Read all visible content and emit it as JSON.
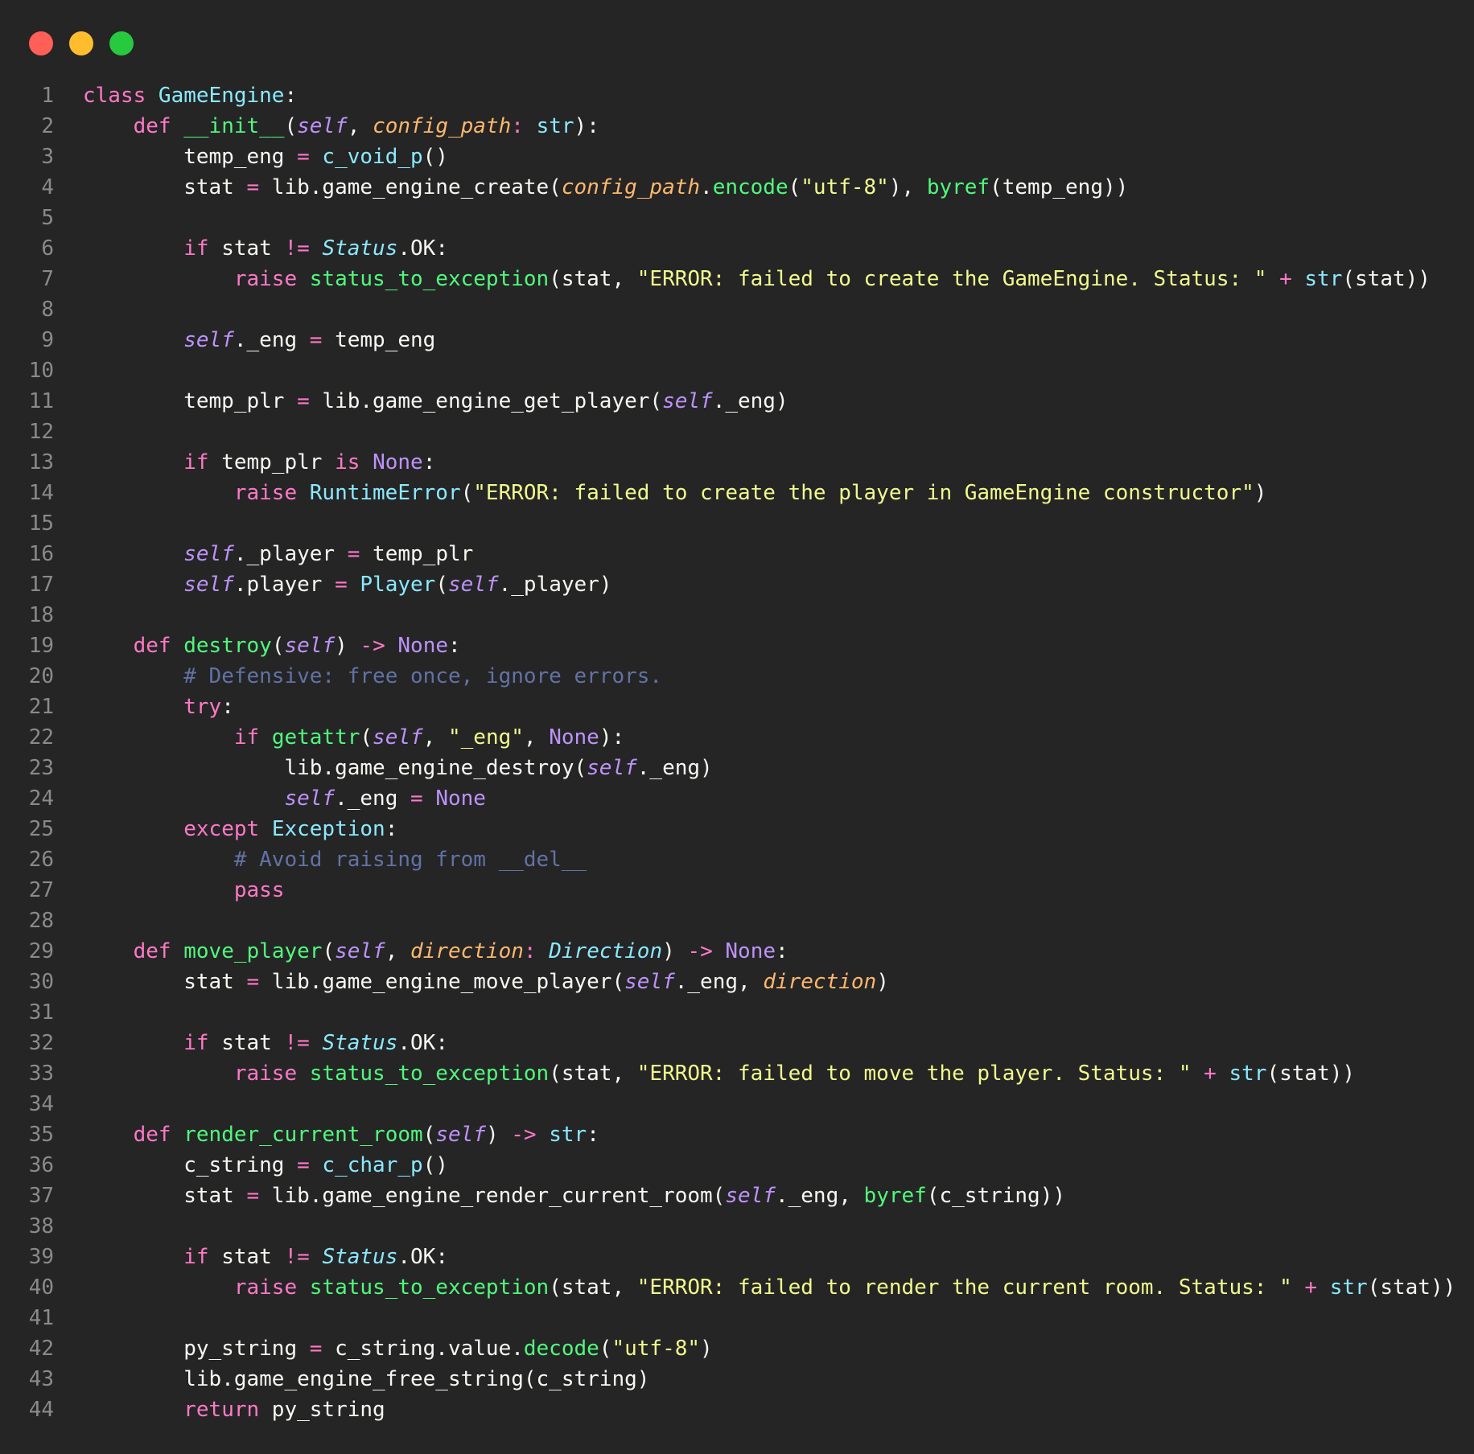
{
  "window": {
    "controls": {
      "close": "close-icon",
      "minimize": "minimize-icon",
      "maximize": "maximize-icon"
    },
    "colors": {
      "background": "#252526",
      "close": "#ff5f56",
      "minimize": "#ffbd2e",
      "maximize": "#27c93f"
    }
  },
  "editor": {
    "lines": [
      [
        [
          "kw",
          "class "
        ],
        [
          "cls",
          "GameEngine"
        ],
        [
          "p",
          ":"
        ]
      ],
      [
        [
          "p",
          "    "
        ],
        [
          "kw",
          "def "
        ],
        [
          "fn",
          "__init__"
        ],
        [
          "p",
          "("
        ],
        [
          "self",
          "self"
        ],
        [
          "p",
          ", "
        ],
        [
          "param",
          "config_path"
        ],
        [
          "op",
          ": "
        ],
        [
          "builtin",
          "str"
        ],
        [
          "p",
          "):"
        ]
      ],
      [
        [
          "p",
          "        temp_eng "
        ],
        [
          "op",
          "="
        ],
        [
          "p",
          " "
        ],
        [
          "cls",
          "c_void_p"
        ],
        [
          "p",
          "()"
        ]
      ],
      [
        [
          "p",
          "        stat "
        ],
        [
          "op",
          "="
        ],
        [
          "p",
          " lib.game_engine_create("
        ],
        [
          "param",
          "config_path"
        ],
        [
          "p",
          "."
        ],
        [
          "fn",
          "encode"
        ],
        [
          "p",
          "("
        ],
        [
          "str",
          "\"utf-8\""
        ],
        [
          "p",
          "), "
        ],
        [
          "fn",
          "byref"
        ],
        [
          "p",
          "(temp_eng))"
        ]
      ],
      [
        [
          "p",
          ""
        ]
      ],
      [
        [
          "p",
          "        "
        ],
        [
          "kw",
          "if"
        ],
        [
          "p",
          " stat "
        ],
        [
          "op",
          "!="
        ],
        [
          "p",
          " "
        ],
        [
          "type",
          "Status"
        ],
        [
          "p",
          ".OK:"
        ]
      ],
      [
        [
          "p",
          "            "
        ],
        [
          "kw",
          "raise "
        ],
        [
          "fn",
          "status_to_exception"
        ],
        [
          "p",
          "(stat, "
        ],
        [
          "str",
          "\"ERROR: failed to create the GameEngine. Status: \""
        ],
        [
          "p",
          " "
        ],
        [
          "op",
          "+"
        ],
        [
          "p",
          " "
        ],
        [
          "builtin",
          "str"
        ],
        [
          "p",
          "(stat))"
        ]
      ],
      [
        [
          "p",
          ""
        ]
      ],
      [
        [
          "p",
          "        "
        ],
        [
          "self",
          "self"
        ],
        [
          "p",
          "._eng "
        ],
        [
          "op",
          "="
        ],
        [
          "p",
          " temp_eng"
        ]
      ],
      [
        [
          "p",
          ""
        ]
      ],
      [
        [
          "p",
          "        temp_plr "
        ],
        [
          "op",
          "="
        ],
        [
          "p",
          " lib.game_engine_get_player("
        ],
        [
          "self",
          "self"
        ],
        [
          "p",
          "._eng)"
        ]
      ],
      [
        [
          "p",
          ""
        ]
      ],
      [
        [
          "p",
          "        "
        ],
        [
          "kw",
          "if"
        ],
        [
          "p",
          " temp_plr "
        ],
        [
          "kw",
          "is"
        ],
        [
          "p",
          " "
        ],
        [
          "const",
          "None"
        ],
        [
          "p",
          ":"
        ]
      ],
      [
        [
          "p",
          "            "
        ],
        [
          "kw",
          "raise "
        ],
        [
          "cls",
          "RuntimeError"
        ],
        [
          "p",
          "("
        ],
        [
          "str",
          "\"ERROR: failed to create the player in GameEngine constructor\""
        ],
        [
          "p",
          ")"
        ]
      ],
      [
        [
          "p",
          ""
        ]
      ],
      [
        [
          "p",
          "        "
        ],
        [
          "self",
          "self"
        ],
        [
          "p",
          "._player "
        ],
        [
          "op",
          "="
        ],
        [
          "p",
          " temp_plr"
        ]
      ],
      [
        [
          "p",
          "        "
        ],
        [
          "self",
          "self"
        ],
        [
          "p",
          ".player "
        ],
        [
          "op",
          "="
        ],
        [
          "p",
          " "
        ],
        [
          "cls",
          "Player"
        ],
        [
          "p",
          "("
        ],
        [
          "self",
          "self"
        ],
        [
          "p",
          "._player)"
        ]
      ],
      [
        [
          "p",
          ""
        ]
      ],
      [
        [
          "p",
          "    "
        ],
        [
          "kw",
          "def "
        ],
        [
          "fn",
          "destroy"
        ],
        [
          "p",
          "("
        ],
        [
          "self",
          "self"
        ],
        [
          "p",
          ") "
        ],
        [
          "op",
          "->"
        ],
        [
          "p",
          " "
        ],
        [
          "const",
          "None"
        ],
        [
          "p",
          ":"
        ]
      ],
      [
        [
          "p",
          "        "
        ],
        [
          "com",
          "# Defensive: free once, ignore errors."
        ]
      ],
      [
        [
          "p",
          "        "
        ],
        [
          "kw",
          "try"
        ],
        [
          "p",
          ":"
        ]
      ],
      [
        [
          "p",
          "            "
        ],
        [
          "kw",
          "if"
        ],
        [
          "p",
          " "
        ],
        [
          "fn",
          "getattr"
        ],
        [
          "p",
          "("
        ],
        [
          "self",
          "self"
        ],
        [
          "p",
          ", "
        ],
        [
          "str",
          "\"_eng\""
        ],
        [
          "p",
          ", "
        ],
        [
          "const",
          "None"
        ],
        [
          "p",
          "):"
        ]
      ],
      [
        [
          "p",
          "                lib.game_engine_destroy("
        ],
        [
          "self",
          "self"
        ],
        [
          "p",
          "._eng)"
        ]
      ],
      [
        [
          "p",
          "                "
        ],
        [
          "self",
          "self"
        ],
        [
          "p",
          "._eng "
        ],
        [
          "op",
          "="
        ],
        [
          "p",
          " "
        ],
        [
          "const",
          "None"
        ]
      ],
      [
        [
          "p",
          "        "
        ],
        [
          "kw",
          "except "
        ],
        [
          "cls",
          "Exception"
        ],
        [
          "p",
          ":"
        ]
      ],
      [
        [
          "p",
          "            "
        ],
        [
          "com",
          "# Avoid raising from __del__"
        ]
      ],
      [
        [
          "p",
          "            "
        ],
        [
          "kw",
          "pass"
        ]
      ],
      [
        [
          "p",
          ""
        ]
      ],
      [
        [
          "p",
          "    "
        ],
        [
          "kw",
          "def "
        ],
        [
          "fn",
          "move_player"
        ],
        [
          "p",
          "("
        ],
        [
          "self",
          "self"
        ],
        [
          "p",
          ", "
        ],
        [
          "param",
          "direction"
        ],
        [
          "op",
          ": "
        ],
        [
          "type",
          "Direction"
        ],
        [
          "p",
          ") "
        ],
        [
          "op",
          "->"
        ],
        [
          "p",
          " "
        ],
        [
          "const",
          "None"
        ],
        [
          "p",
          ":"
        ]
      ],
      [
        [
          "p",
          "        stat "
        ],
        [
          "op",
          "="
        ],
        [
          "p",
          " lib.game_engine_move_player("
        ],
        [
          "self",
          "self"
        ],
        [
          "p",
          "._eng, "
        ],
        [
          "param",
          "direction"
        ],
        [
          "p",
          ")"
        ]
      ],
      [
        [
          "p",
          ""
        ]
      ],
      [
        [
          "p",
          "        "
        ],
        [
          "kw",
          "if"
        ],
        [
          "p",
          " stat "
        ],
        [
          "op",
          "!="
        ],
        [
          "p",
          " "
        ],
        [
          "type",
          "Status"
        ],
        [
          "p",
          ".OK:"
        ]
      ],
      [
        [
          "p",
          "            "
        ],
        [
          "kw",
          "raise "
        ],
        [
          "fn",
          "status_to_exception"
        ],
        [
          "p",
          "(stat, "
        ],
        [
          "str",
          "\"ERROR: failed to move the player. Status: \""
        ],
        [
          "p",
          " "
        ],
        [
          "op",
          "+"
        ],
        [
          "p",
          " "
        ],
        [
          "builtin",
          "str"
        ],
        [
          "p",
          "(stat))"
        ]
      ],
      [
        [
          "p",
          ""
        ]
      ],
      [
        [
          "p",
          "    "
        ],
        [
          "kw",
          "def "
        ],
        [
          "fn",
          "render_current_room"
        ],
        [
          "p",
          "("
        ],
        [
          "self",
          "self"
        ],
        [
          "p",
          ") "
        ],
        [
          "op",
          "->"
        ],
        [
          "p",
          " "
        ],
        [
          "builtin",
          "str"
        ],
        [
          "p",
          ":"
        ]
      ],
      [
        [
          "p",
          "        c_string "
        ],
        [
          "op",
          "="
        ],
        [
          "p",
          " "
        ],
        [
          "cls",
          "c_char_p"
        ],
        [
          "p",
          "()"
        ]
      ],
      [
        [
          "p",
          "        stat "
        ],
        [
          "op",
          "="
        ],
        [
          "p",
          " lib.game_engine_render_current_room("
        ],
        [
          "self",
          "self"
        ],
        [
          "p",
          "._eng, "
        ],
        [
          "fn",
          "byref"
        ],
        [
          "p",
          "(c_string))"
        ]
      ],
      [
        [
          "p",
          ""
        ]
      ],
      [
        [
          "p",
          "        "
        ],
        [
          "kw",
          "if"
        ],
        [
          "p",
          " stat "
        ],
        [
          "op",
          "!="
        ],
        [
          "p",
          " "
        ],
        [
          "type",
          "Status"
        ],
        [
          "p",
          ".OK:"
        ]
      ],
      [
        [
          "p",
          "            "
        ],
        [
          "kw",
          "raise "
        ],
        [
          "fn",
          "status_to_exception"
        ],
        [
          "p",
          "(stat, "
        ],
        [
          "str",
          "\"ERROR: failed to render the current room. Status: \""
        ],
        [
          "p",
          " "
        ],
        [
          "op",
          "+"
        ],
        [
          "p",
          " "
        ],
        [
          "builtin",
          "str"
        ],
        [
          "p",
          "(stat))"
        ]
      ],
      [
        [
          "p",
          ""
        ]
      ],
      [
        [
          "p",
          "        py_string "
        ],
        [
          "op",
          "="
        ],
        [
          "p",
          " c_string.value."
        ],
        [
          "fn",
          "decode"
        ],
        [
          "p",
          "("
        ],
        [
          "str",
          "\"utf-8\""
        ],
        [
          "p",
          ")"
        ]
      ],
      [
        [
          "p",
          "        lib.game_engine_free_string(c_string)"
        ]
      ],
      [
        [
          "p",
          "        "
        ],
        [
          "kw",
          "return"
        ],
        [
          "p",
          " py_string"
        ]
      ]
    ]
  }
}
